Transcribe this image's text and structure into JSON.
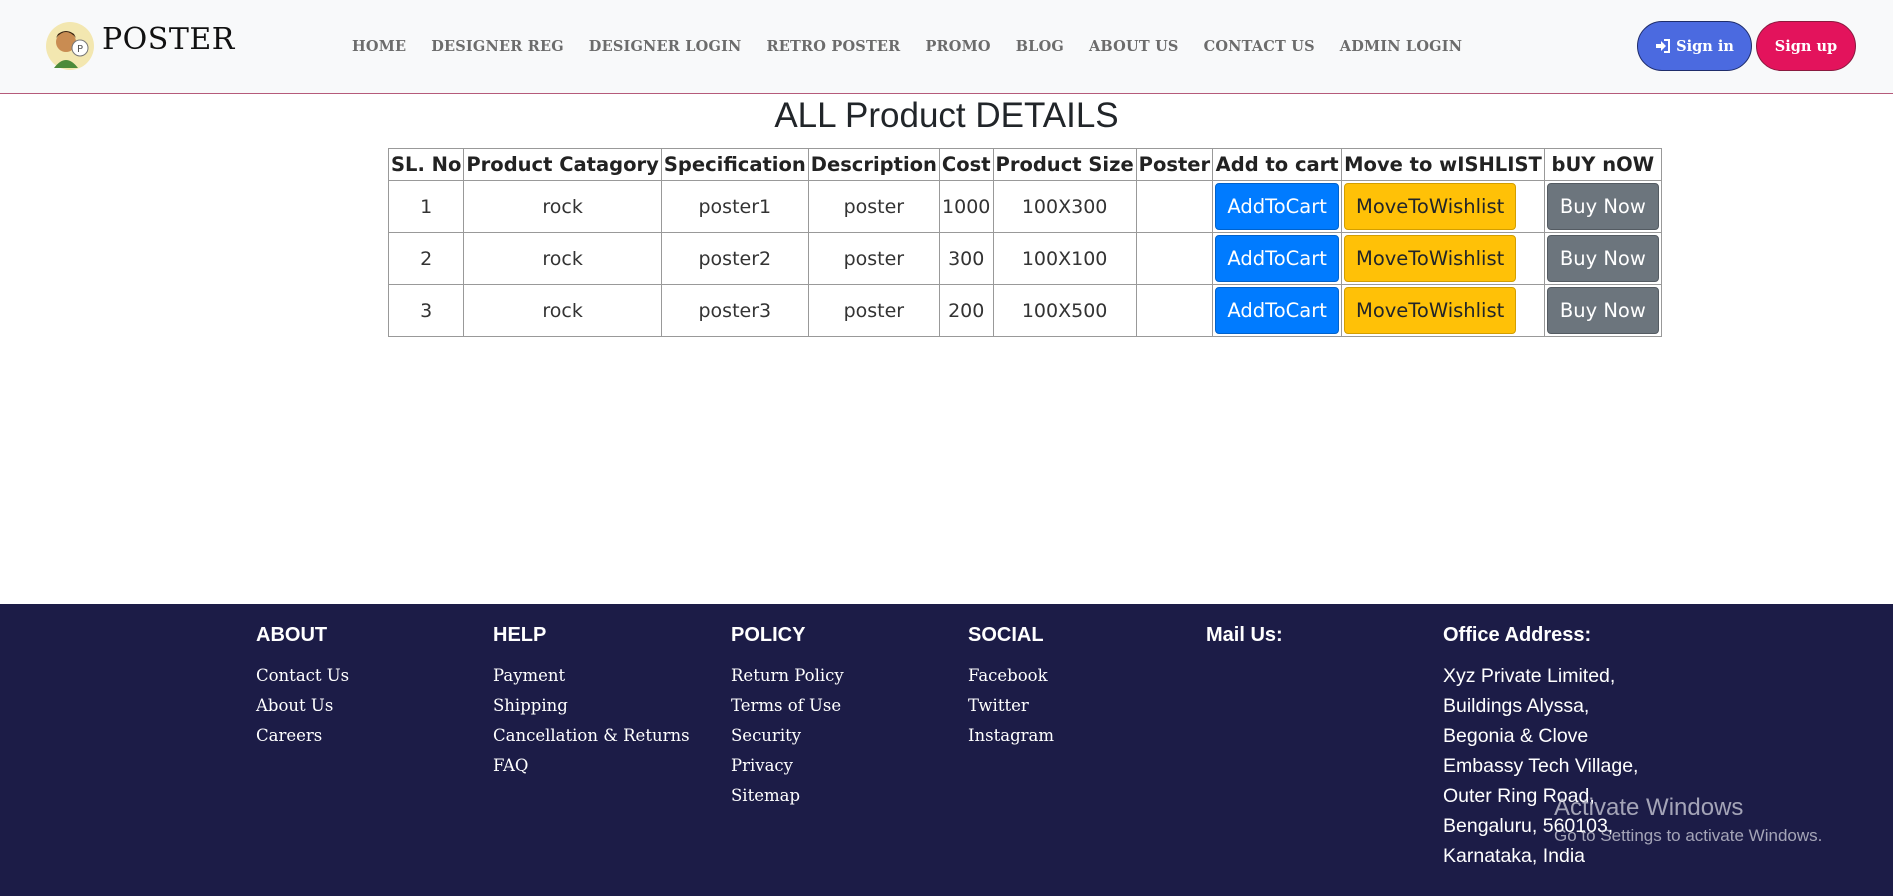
{
  "header": {
    "brand": "POSTER",
    "nav": [
      "HOME",
      "DESIGNER REG",
      "DESIGNER LOGIN",
      "RETRO POSTER",
      "PROMO",
      "BLOG",
      "ABOUT US",
      "CONTACT US",
      "ADMIN LOGIN"
    ],
    "signin_label": "Sign in",
    "signup_label": "Sign up",
    "colors": {
      "signin": "#4b6ae0",
      "signup": "#e3135c"
    }
  },
  "main": {
    "title": "ALL Product DETAILS",
    "columns": [
      "SL. No",
      "Product Catagory",
      "Specification",
      "Description",
      "Cost",
      "Product Size",
      "Poster",
      "Add to cart",
      "Move to wISHLIST",
      "bUY nOW"
    ],
    "rows": [
      {
        "sl": "1",
        "category": "rock",
        "spec": "poster1",
        "desc": "poster",
        "cost": "1000",
        "size": "100X300",
        "poster": ""
      },
      {
        "sl": "2",
        "category": "rock",
        "spec": "poster2",
        "desc": "poster",
        "cost": "300",
        "size": "100X100",
        "poster": ""
      },
      {
        "sl": "3",
        "category": "rock",
        "spec": "poster3",
        "desc": "poster",
        "cost": "200",
        "size": "100X500",
        "poster": ""
      }
    ],
    "buttons": {
      "add": "AddToCart",
      "wishlist": "MoveToWishlist",
      "buy": "Buy Now"
    },
    "button_colors": {
      "add": "#007bff",
      "wishlist": "#ffc107",
      "buy": "#6c757d"
    }
  },
  "footer": {
    "about": {
      "heading": "ABOUT",
      "links": [
        "Contact Us",
        "About Us",
        "Careers"
      ]
    },
    "help": {
      "heading": "HELP",
      "links": [
        "Payment",
        "Shipping",
        "Cancellation & Returns",
        "FAQ"
      ]
    },
    "policy": {
      "heading": "POLICY",
      "links": [
        "Return Policy",
        "Terms of Use",
        "Security",
        "Privacy",
        "Sitemap"
      ]
    },
    "social": {
      "heading": "SOCIAL",
      "links": [
        "Facebook",
        "Twitter",
        "Instagram"
      ]
    },
    "mail": {
      "heading": "Mail Us:"
    },
    "office": {
      "heading": "Office Address:",
      "lines": [
        "Xyz Private Limited,",
        "Buildings Alyssa,",
        "Begonia & Clove",
        "Embassy Tech Village,",
        "Outer Ring Road,",
        "Bengaluru, 560103,",
        "Karnataka, India"
      ]
    },
    "background": "#1c1c47"
  },
  "watermark": {
    "line1": "Activate Windows",
    "line2": "Go to Settings to activate Windows."
  }
}
